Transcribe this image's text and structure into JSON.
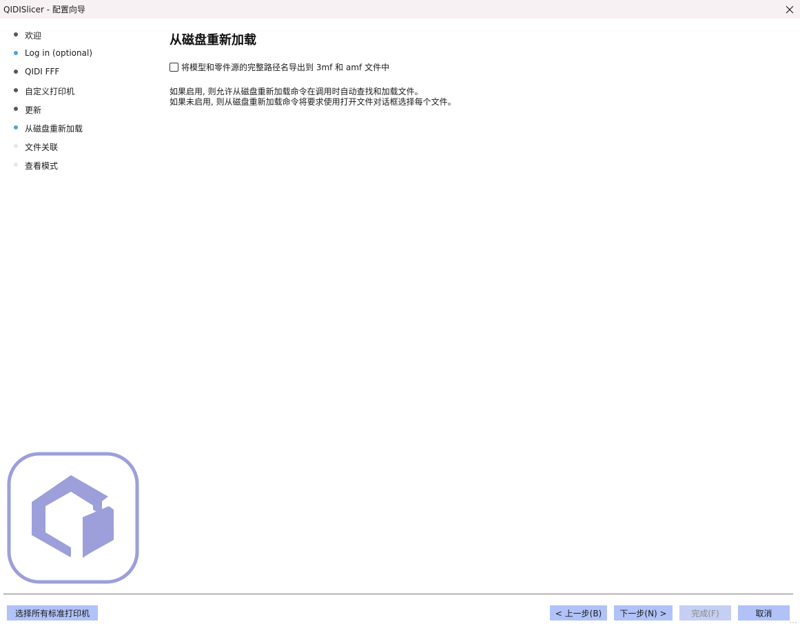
{
  "window": {
    "title": "QIDISlicer - 配置向导"
  },
  "sidebar": {
    "steps": [
      {
        "label": "欢迎",
        "dot_color": "#555555"
      },
      {
        "label": "Log in (optional)",
        "dot_color": "#4aa3d8"
      },
      {
        "label": "QIDI FFF",
        "dot_color": "#555555"
      },
      {
        "label": "自定义打印机",
        "dot_color": "#555555"
      },
      {
        "label": "更新",
        "dot_color": "#555555"
      },
      {
        "label": "从磁盘重新加载",
        "dot_color": "#4aa3d8"
      },
      {
        "label": "文件关联",
        "dot_color": "#e6e6e6"
      },
      {
        "label": "查看模式",
        "dot_color": "#e6e6e6"
      }
    ]
  },
  "main": {
    "title": "从磁盘重新加载",
    "checkbox": {
      "label": "将模型和零件源的完整路径名导出到 3mf 和 amf 文件中",
      "checked": false
    },
    "description": [
      "如果启用, 则允许从磁盘重新加载命令在调用时自动查找和加载文件。",
      "如果未启用, 则从磁盘重新加载命令将要求使用打开文件对话框选择每个文件。"
    ]
  },
  "footer": {
    "select_all_label": "选择所有标准打印机",
    "back_label": "< 上一步(B)",
    "next_label": "下一步(N) >",
    "finish_label": "完成(F)",
    "cancel_label": "取消"
  },
  "colors": {
    "button_bg": "#b0c2f8",
    "button_disabled_bg": "#c4cff3",
    "logo": "#9c9fda",
    "titlebar_bg": "#f7f1f3"
  }
}
